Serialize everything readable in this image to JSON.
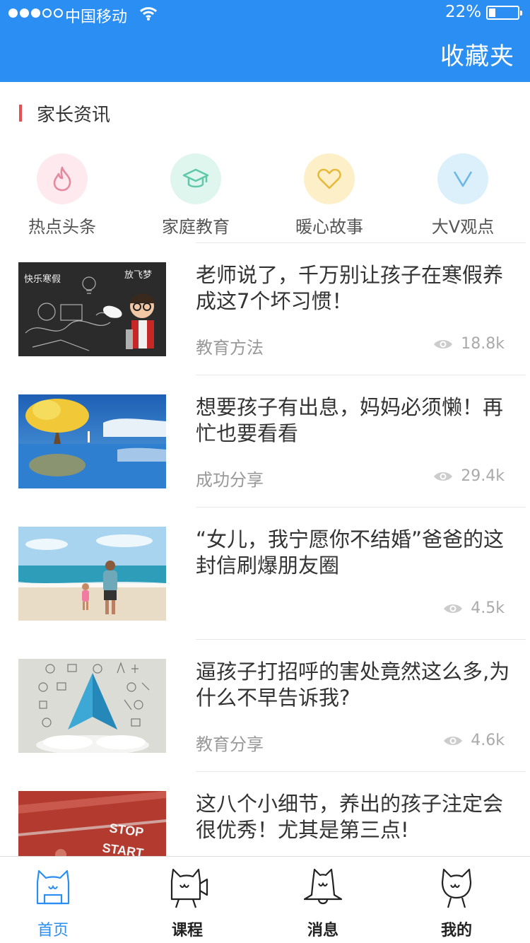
{
  "status_bar": {
    "carrier": "中国移动",
    "battery": "22%"
  },
  "header": {
    "favorites": "收藏夹"
  },
  "section": {
    "title": "家长资讯"
  },
  "categories": [
    {
      "label": "热点头条",
      "icon": "flame-icon",
      "color": "#e48aa0",
      "bg": "#fde9ee"
    },
    {
      "label": "家庭教育",
      "icon": "graduation-cap-icon",
      "color": "#5fc8a8",
      "bg": "#dff6ef"
    },
    {
      "label": "暖心故事",
      "icon": "heart-icon",
      "color": "#e8b83a",
      "bg": "#fdf0c9"
    },
    {
      "label": "大V观点",
      "icon": "v-icon",
      "color": "#6bb7e6",
      "bg": "#dcf0fb"
    }
  ],
  "articles": [
    {
      "title": "老师说了，千万别让孩子在寒假养成这7个坏习惯！",
      "tag": "教育方法",
      "views": "18.8k",
      "thumb_text_1": "快乐寒假",
      "thumb_text_2": "放飞梦"
    },
    {
      "title": "想要孩子有出息，妈妈必须懒！再忙也要看看",
      "tag": "成功分享",
      "views": "29.4k"
    },
    {
      "title": "“女儿，我宁愿你不结婚”爸爸的这封信刷爆朋友圈",
      "tag": "",
      "views": "4.5k"
    },
    {
      "title": "逼孩子打招呼的害处竟然这么多,为什么不早告诉我?",
      "tag": "教育分享",
      "views": "4.6k"
    },
    {
      "title": "这八个小细节，养出的孩子注定会很优秀！尤其是第三点!",
      "tag": "",
      "views": "",
      "thumb_text_1": "STOP",
      "thumb_text_2": "START"
    }
  ],
  "tabs": [
    {
      "label": "首页",
      "icon": "home-cat-icon",
      "active": true
    },
    {
      "label": "课程",
      "icon": "course-cat-icon",
      "active": false
    },
    {
      "label": "消息",
      "icon": "message-cat-icon",
      "active": false
    },
    {
      "label": "我的",
      "icon": "profile-cat-icon",
      "active": false
    }
  ],
  "colors": {
    "primary": "#2a8ef3",
    "section_bar": "#e84e4e"
  }
}
